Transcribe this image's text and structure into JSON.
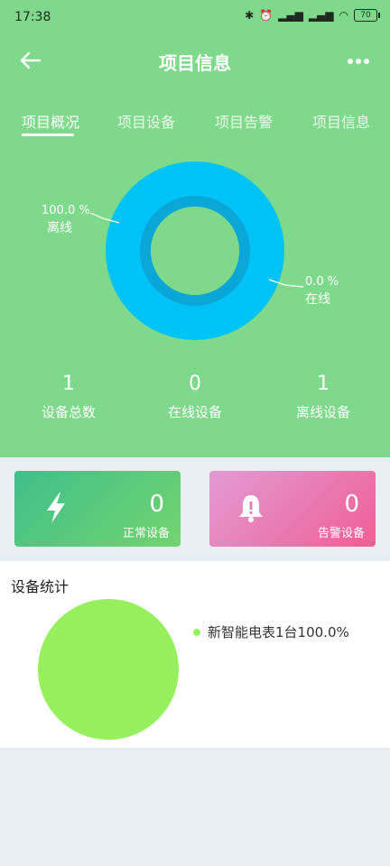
{
  "status_bar": {
    "time": "17:38",
    "battery": "70"
  },
  "header": {
    "title": "项目信息"
  },
  "tabs": [
    {
      "label": "项目概况"
    },
    {
      "label": "项目设备"
    },
    {
      "label": "项目告警"
    },
    {
      "label": "项目信息"
    }
  ],
  "donut": {
    "offline_pct": "100.0 %",
    "offline_label": "离线",
    "online_pct": "0.0 %",
    "online_label": "在线",
    "offline_fraction": 1.0,
    "color": "#00c3f5"
  },
  "stats": [
    {
      "value": "1",
      "label": "设备总数"
    },
    {
      "value": "0",
      "label": "在线设备"
    },
    {
      "value": "1",
      "label": "离线设备"
    }
  ],
  "cards": {
    "normal": {
      "count": "0",
      "label": "正常设备"
    },
    "alarm": {
      "count": "0",
      "label": "告警设备"
    }
  },
  "device_stats": {
    "title": "设备统计",
    "legend": "新智能电表1台100.0%",
    "color": "#96ef5c"
  },
  "icons": {
    "back": "arrow-left-icon",
    "more": "more-dots-icon",
    "normal": "lightning-icon",
    "alarm": "bell-icon"
  },
  "colors": {
    "header_bg": "#7ed98a",
    "page_bg": "#e9eef2"
  }
}
